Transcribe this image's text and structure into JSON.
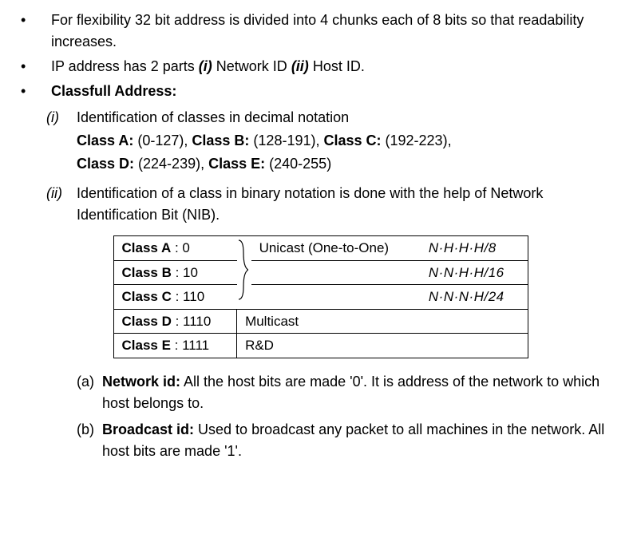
{
  "bullets": {
    "b1": "For flexibility 32 bit address is divided into 4 chunks each of 8 bits so that readability increases.",
    "b2_pre": "IP address has 2 parts ",
    "b2_i_marker": "(i)",
    "b2_i_text": " Network ID ",
    "b2_ii_marker": "(ii)",
    "b2_ii_text": " Host ID.",
    "b3": "Classfull Address:"
  },
  "roman": {
    "i_marker": "(i)",
    "i_text": "Identification of classes in decimal notation",
    "ii_marker": "(ii)",
    "ii_text": "Identification of a class in binary notation is done with the help of Network Identification Bit (NIB)."
  },
  "classes_line1": {
    "a_label": "Class A:",
    "a_range": " (0-127), ",
    "b_label": "Class B:",
    "b_range": " (128-191), ",
    "c_label": "Class C:",
    "c_range": " (192-223),"
  },
  "classes_line2": {
    "d_label": "Class D:",
    "d_range": " (224-239), ",
    "e_label": "Class E:",
    "e_range": " (240-255)"
  },
  "table": {
    "rows": [
      {
        "cls_label": "Class A",
        "bits": " : 0",
        "type": "Unicast (One-to-One)",
        "mask": "N·H·H·H/8"
      },
      {
        "cls_label": "Class B",
        "bits": " : 10",
        "type": "",
        "mask": "N·N·H·H/16"
      },
      {
        "cls_label": "Class C",
        "bits": " : 110",
        "type": "",
        "mask": "N·N·N·H/24"
      },
      {
        "cls_label": "Class D",
        "bits": " : 1110",
        "type": "Multicast",
        "mask": ""
      },
      {
        "cls_label": "Class E",
        "bits": " : 1111",
        "type": "R&D",
        "mask": ""
      }
    ]
  },
  "alpha": {
    "a_marker": "(a)",
    "a_label": "Network id:",
    "a_text": " All the host bits are made '0'. It is address of the network to which host belongs to.",
    "b_marker": "(b)",
    "b_label": "Broadcast id:",
    "b_text": " Used to broadcast any packet to all machines in the network. All host bits are made '1'."
  }
}
